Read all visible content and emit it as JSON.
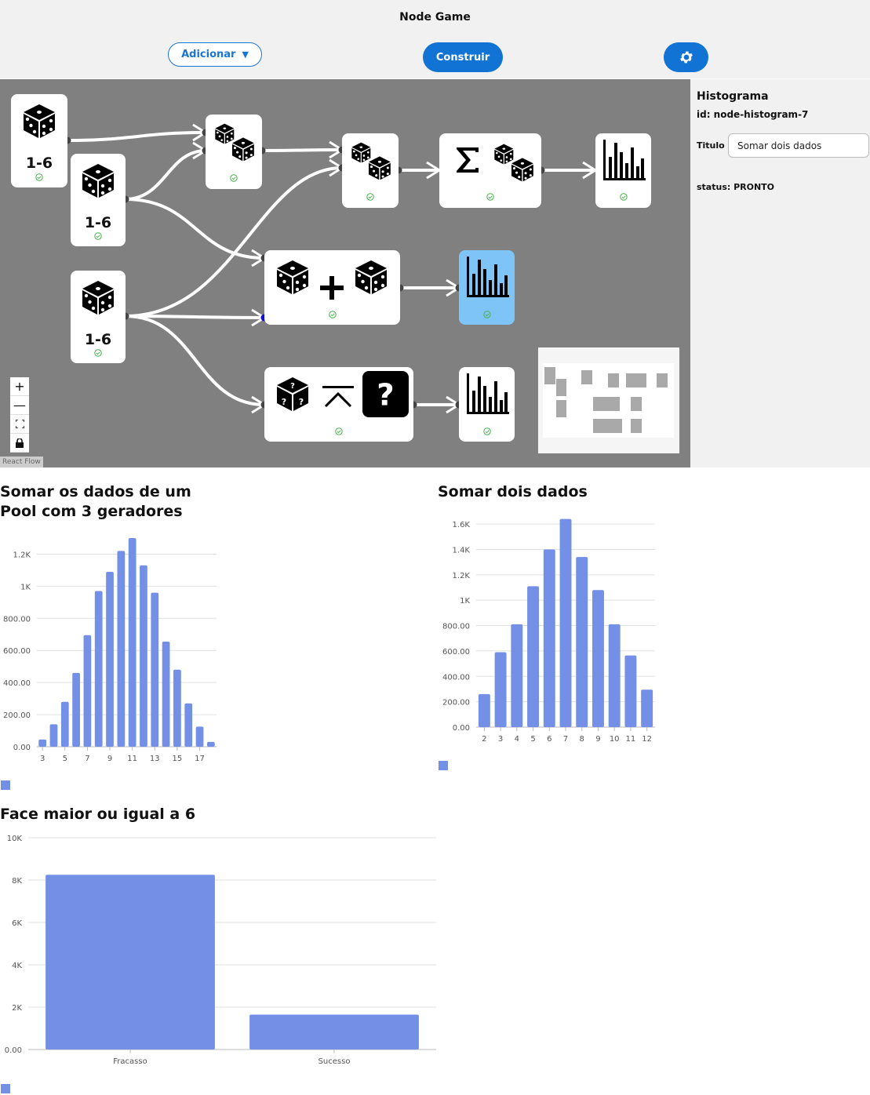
{
  "app": {
    "title": "Node Game"
  },
  "toolbar": {
    "add_label": "Adicionar",
    "build_label": "Construir",
    "settings_icon": "gear-icon"
  },
  "canvas": {
    "dice_range_label": "1-6",
    "attribution": "React Flow",
    "controls": [
      "zoom-in",
      "zoom-out",
      "fit-view",
      "lock"
    ],
    "colors": {
      "background": "#808080",
      "selected_node": "#7fc4f7",
      "edge": "#ffffff"
    }
  },
  "panel": {
    "title": "Histograma",
    "node_id": "id: node-histogram-7",
    "titulo_label": "Titulo :",
    "titulo_value": "Somar dois dados",
    "status": "status: PRONTO"
  },
  "charts": {
    "pool": {
      "title_line1": "Somar os dados de um",
      "title_line2": "Pool com 3 geradores",
      "chart_data": {
        "type": "bar",
        "title": "Somar os dados de um Pool com 3 geradores",
        "categories": [
          "3",
          "4",
          "5",
          "6",
          "7",
          "8",
          "9",
          "10",
          "11",
          "12",
          "13",
          "14",
          "15",
          "16",
          "17",
          "18"
        ],
        "values": [
          45,
          140,
          280,
          460,
          695,
          970,
          1090,
          1220,
          1300,
          1130,
          960,
          655,
          480,
          270,
          125,
          30
        ],
        "x_tick_labels": [
          "3",
          "5",
          "7",
          "9",
          "11",
          "13",
          "15",
          "17"
        ],
        "y_ticks": [
          "0.00",
          "200.00",
          "400.00",
          "600.00",
          "800.00",
          "1K",
          "1.2K"
        ],
        "ylim": [
          0,
          1300
        ],
        "grid": true,
        "color": "#738fe6"
      }
    },
    "dois": {
      "title": "Somar dois dados",
      "chart_data": {
        "type": "bar",
        "title": "Somar dois dados",
        "categories": [
          "2",
          "3",
          "4",
          "5",
          "6",
          "7",
          "8",
          "9",
          "10",
          "11",
          "12"
        ],
        "values": [
          260,
          590,
          810,
          1110,
          1400,
          1640,
          1340,
          1080,
          810,
          565,
          295
        ],
        "y_ticks": [
          "0.00",
          "200.00",
          "400.00",
          "600.00",
          "800.00",
          "1K",
          "1.2K",
          "1.4K",
          "1.6K"
        ],
        "ylim": [
          0,
          1650
        ],
        "grid": true,
        "color": "#738fe6"
      }
    },
    "face": {
      "title": "Face maior ou igual a 6",
      "chart_data": {
        "type": "bar",
        "title": "Face maior ou igual a 6",
        "categories": [
          "Fracasso",
          "Sucesso"
        ],
        "values": [
          8250,
          1650
        ],
        "y_ticks": [
          "0.00",
          "2K",
          "4K",
          "6K",
          "8K",
          "10K"
        ],
        "ylim": [
          0,
          10000
        ],
        "grid": true,
        "color": "#738fe6"
      }
    }
  }
}
